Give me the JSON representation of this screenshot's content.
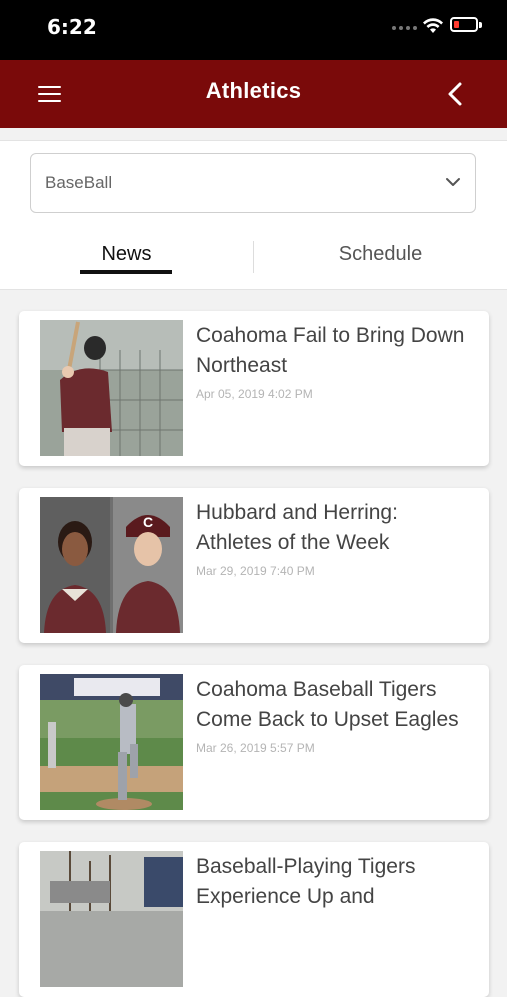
{
  "status_bar": {
    "time": "6:22"
  },
  "header": {
    "title": "Athletics",
    "menu_icon": "hamburger-menu-icon",
    "back_icon": "chevron-left-icon"
  },
  "filter": {
    "selected": "BaseBall",
    "chevron_icon": "chevron-down-icon"
  },
  "tabs": [
    {
      "label": "News",
      "active": true
    },
    {
      "label": "Schedule",
      "active": false
    }
  ],
  "news": [
    {
      "title": "Coahoma Fail to Bring Down Northeast",
      "date": "Apr 05, 2019 4:02 PM"
    },
    {
      "title": "Hubbard and Herring: Athletes of the Week",
      "date": "Mar 29, 2019 7:40 PM"
    },
    {
      "title": "Coahoma Baseball Tigers Come Back to Upset Eagles",
      "date": "Mar 26, 2019 5:57 PM"
    },
    {
      "title": "Baseball-Playing Tigers Experience Up and",
      "date": ""
    }
  ],
  "colors": {
    "header_bg": "#7a0a0a",
    "status_bar_bg": "#000000",
    "accent_underline": "#111111",
    "battery_low": "#ff3b30"
  }
}
